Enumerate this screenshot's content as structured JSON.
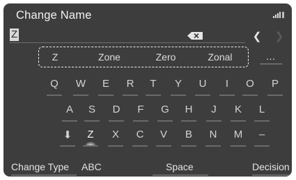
{
  "header": {
    "title": "Change Name",
    "signal_icon": "signal-bars-icon"
  },
  "input": {
    "value": "Z",
    "backspace_icon": "backspace-icon"
  },
  "nav": {
    "left_icon": "chevron-left-icon",
    "right_icon": "chevron-right-icon"
  },
  "suggestions": [
    "Z",
    "Zone",
    "Zero",
    "Zonal"
  ],
  "more_label": "…",
  "keyboard": {
    "row1": [
      "Q",
      "W",
      "E",
      "R",
      "T",
      "Y",
      "U",
      "I",
      "O",
      "P"
    ],
    "row2": [
      "A",
      "S",
      "D",
      "F",
      "G",
      "H",
      "J",
      "K",
      "L"
    ],
    "row3": [
      "⬇",
      "Z",
      "X",
      "C",
      "V",
      "B",
      "N",
      "M",
      "–"
    ],
    "selected_key": "Z"
  },
  "bottom": {
    "change_type": "Change Type",
    "abc": "ABC",
    "space": "Space",
    "decision": "Decision"
  },
  "colors": {
    "background": "#3d3d3d",
    "text": "#ececec",
    "underline": "#6a6a6a"
  }
}
